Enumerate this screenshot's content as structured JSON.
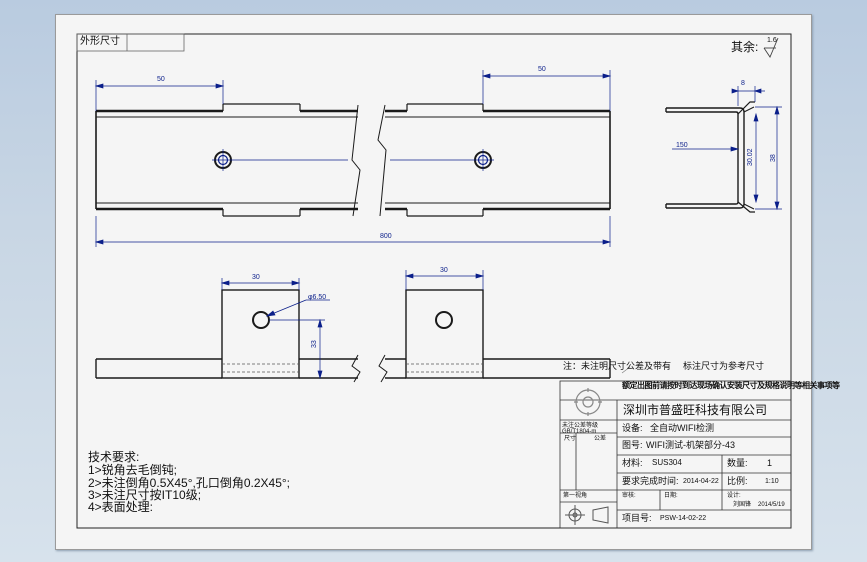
{
  "colors": {
    "sheet": "#f5f5f5",
    "outline": "#1a1a1a",
    "dimension": "#0b1f8a",
    "hidden": "#555555"
  },
  "corner_tab": "外形尺寸",
  "surface_note": {
    "label": "其余:",
    "symbol": "1.6"
  },
  "dims": {
    "d50_left": "50",
    "d50_right": "50",
    "d800": "800",
    "d8": "8",
    "d150": "150",
    "d30_02": "30.02",
    "d38": "38",
    "d30_left": "30",
    "d30_right": "30",
    "d_hole": "φ6.50",
    "d33": "33"
  },
  "notes": {
    "tolerance": "注：未注明尺寸公差及带有",
    "tolerance_2": "标注尺寸为参考尺寸",
    "garbled": "额定出图前请按时到达现场确认安装尺寸及规格说明等相关事项等"
  },
  "title_block": {
    "company": "深圳市普盛旺科技有限公司",
    "device_label": "设备:",
    "device_value": "全自动WIFI检测",
    "drawing_label": "图号:",
    "drawing_value": "WIFI测试-机架部分-43",
    "material_label": "材料:",
    "material_value": "SUS304",
    "qty_label": "数量:",
    "qty_value": "1",
    "due_label": "要求完成时间:",
    "due_value": "2014-04-22",
    "scale_label": "比例:",
    "scale_value": "1:10",
    "project_label": "项目号:",
    "project_value": "PSW-14-02-22",
    "audit_label": "审核:",
    "date_label": "日期:",
    "drafter_label": "设计:",
    "drafter_value": "刘国锋",
    "drafter_date": "2014/5/19",
    "left_header": "未注公差等级GB/T1804-m",
    "left_size": "尺寸",
    "left_tol": "公差",
    "angle_label": "第一视角"
  },
  "tech_requirements": {
    "title": "技术要求:",
    "items": [
      "1>锐角去毛倒钝;",
      "2>未注倒角0.5X45°,孔口倒角0.2X45°;",
      "3>未注尺寸按IT10级;",
      "4>表面处理:"
    ]
  }
}
